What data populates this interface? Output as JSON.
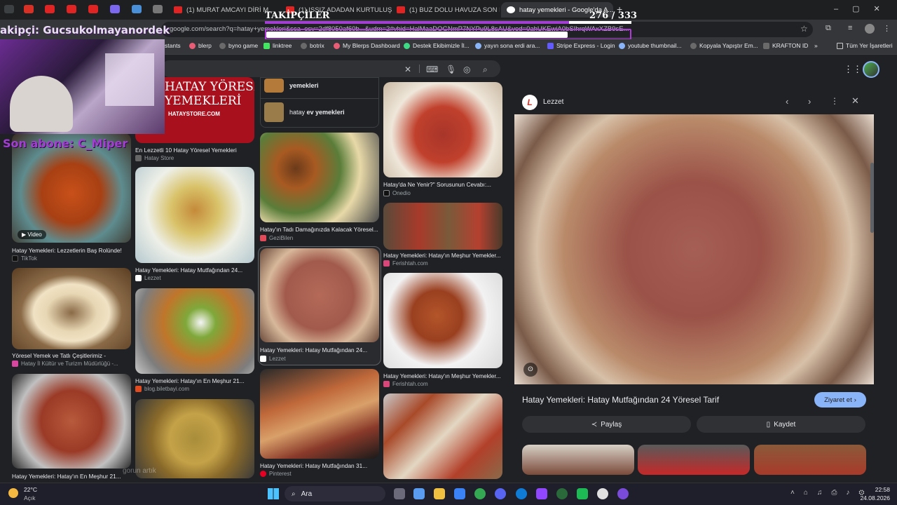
{
  "tabs": [
    {
      "label": "(1) MURAT AMCAYI DİRİ M..."
    },
    {
      "label": "(1) ISSIZ ADADAN KURTULUŞ"
    },
    {
      "label": "(1) BUZ DOLU HAVUZA SON DI..."
    },
    {
      "label": "hatay yemekleri - Google'da A..."
    }
  ],
  "address": {
    "url": "google.com/search?q=hatay+yemekleri&sca_esv=2df8050af60b...&udm=2#vhid=HalMaaDOGNmP7NYPu9L8sAU&ved=0ahUKEwiA0bSIhrqWAxXZB9sE..."
  },
  "bookmarks": [
    "stants",
    "blerp",
    "byno game",
    "linktree",
    "botrix",
    "My Blerps Dashboard",
    "Destek Ekibimizle İl...",
    "yayın sona erdi ara...",
    "Stripe Express - Login",
    "youtube thumbnail...",
    "Kopyala Yapıştır Em...",
    "KRAFTON ID",
    "Tüm Yer İşaretleri"
  ],
  "overlay": {
    "followers_label": "TAKİPÇİLER",
    "followers_count": "276 / 333",
    "bit_text": "akipçi: Gucsukolmayanordek",
    "last_sub": "Son abone: C_Miper"
  },
  "related": [
    {
      "label": "yemekleri"
    },
    {
      "label_plain": "hatay ",
      "label_bold": "ev yemekleri"
    }
  ],
  "col1": [
    {
      "caption": "Hatay Yemekleri: Lezzetlerin Baş Rolünde!",
      "source": "TikTok",
      "badge": "Video"
    },
    {
      "caption": "Yöresel Yemek ve Tatlı Çeşitlerimiz -",
      "source": "Hatay İl Kültür ve Turizm Müdürlüğü -..."
    },
    {
      "caption": "Hatay Yemekleri: Hatay'ın En Meşhur 21..."
    }
  ],
  "col2": [
    {
      "caption": "En Lezzetli 10 Hatay Yöresel Yemekleri",
      "source": "Hatay Store",
      "banner_title": "HATAY YÖRESEL\nYEMEKLERİ",
      "banner_site": "HATAYSTORE.COM"
    },
    {
      "caption": "Hatay Yemekleri: Hatay Mutfağından 24...",
      "source": "Lezzet"
    },
    {
      "caption": "Hatay Yemekleri: Hatay'ın En Meşhur 21...",
      "source": "blog.biletbayi.com"
    }
  ],
  "col3": [
    {
      "caption": "Hatay'ın Tadı Damağınızda Kalacak Yöresel...",
      "source": "GeziBilen"
    },
    {
      "caption": "Hatay Yemekleri: Hatay Mutfağından 24...",
      "source": "Lezzet"
    },
    {
      "caption": "Hatay Yemekleri: Hatay Mutfağından 31...",
      "source": "Pinterest"
    }
  ],
  "col4": [
    {
      "caption": "Hatay'da Ne Yenir?\" Sorusunun Cevabı:...",
      "source": "Onedio"
    },
    {
      "caption": "Hatay Yemekleri: Hatay'ın Meşhur Yemekler...",
      "source": "Ferishtah.com"
    },
    {
      "caption": "Hatay Yemekleri: Hatay'ın Meşhur Yemekler...",
      "source": "Ferishtah.com"
    }
  ],
  "panel": {
    "source": "Lezzet",
    "title": "Hatay Yemekleri: Hatay Mutfağından 24 Yöresel Tarif",
    "visit": "Ziyaret et",
    "share": "Paylaş",
    "save": "Kaydet"
  },
  "chat_ghost": "gorun artık",
  "taskbar": {
    "temp": "22°C",
    "weather": "Açık",
    "search": "Ara",
    "time": "22:58",
    "date": "24.08.2026"
  },
  "colors": {
    "accent": "#8ab4f8",
    "brand_red": "#e02424",
    "overlay_purple": "#a03fd0"
  }
}
